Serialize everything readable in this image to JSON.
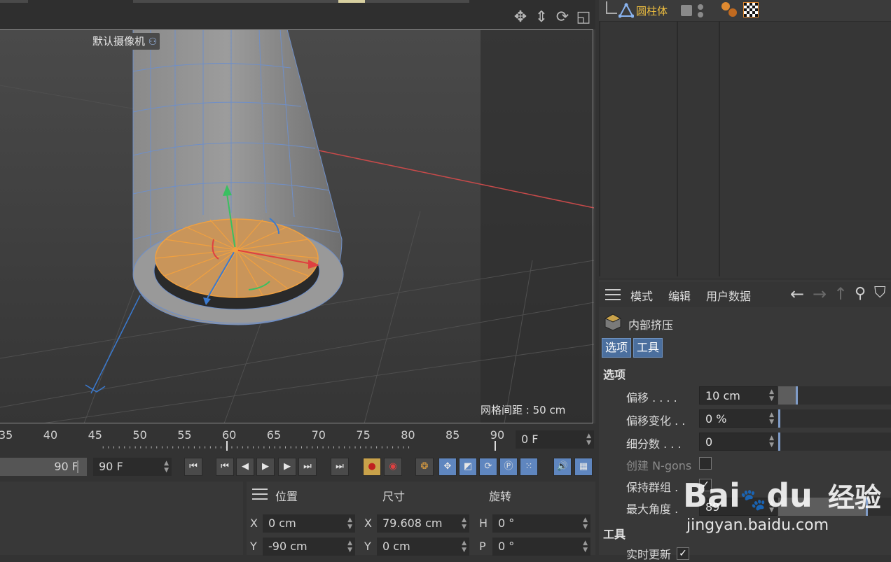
{
  "viewport": {
    "camera_label": "默认摄像机",
    "grid_spacing": "网格间距 : 50 cm",
    "nav_icons": [
      "move-view-icon",
      "dolly-view-icon",
      "rotate-view-icon",
      "toggle-view-icon"
    ]
  },
  "object_manager": {
    "object_name": "圆柱体"
  },
  "attribute_manager": {
    "menu": [
      "模式",
      "编辑",
      "用户数据"
    ],
    "tool_name": "内部挤压",
    "tabs": [
      "选项",
      "工具"
    ],
    "options_header": "选项",
    "fields": [
      {
        "label": "偏移 . . . .",
        "value": "10 cm",
        "slider": 0.16
      },
      {
        "label": "偏移变化 . .",
        "value": "0 %",
        "slider": 0.0
      },
      {
        "label": "细分数 . . .",
        "value": "0",
        "slider": 0.0
      }
    ],
    "create_ngons": "创建 N-gons",
    "keep_groups": "保持群组 .",
    "max_angle_label": "最大角度 .",
    "max_angle_value": "89",
    "max_angle_slider": 0.78,
    "tool_header": "工具",
    "realtime_update": "实时更新"
  },
  "timeline": {
    "ticks": [
      "35",
      "40",
      "45",
      "50",
      "55",
      "60",
      "65",
      "70",
      "75",
      "80",
      "85",
      "90"
    ],
    "current_frame": "0 F",
    "end_field_1": "90 F",
    "end_field_2": "90 F"
  },
  "coordinates": {
    "headers": [
      "位置",
      "尺寸",
      "旋转"
    ],
    "rows": [
      {
        "axis_a": "X",
        "pos": "0 cm",
        "axis_b": "X",
        "size": "79.608 cm",
        "axis_c": "H",
        "rot": "0 °"
      },
      {
        "axis_a": "Y",
        "pos": "-90 cm",
        "axis_b": "Y",
        "size": "0 cm",
        "axis_c": "P",
        "rot": "0 °"
      }
    ]
  },
  "watermark": {
    "brand": "Bai",
    "brand2": "du",
    "cn": "经验",
    "url": "jingyan.baidu.com"
  },
  "colors": {
    "accent_blue": "#5f86bf",
    "object_name": "#f0c040",
    "selection_orange": "#f0a040"
  }
}
